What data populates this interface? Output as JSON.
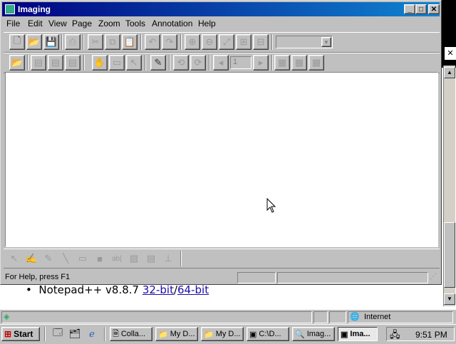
{
  "imaging_window": {
    "title": "Imaging",
    "caption_buttons": {
      "minimize": "_",
      "maximize": "□",
      "close": "✕"
    },
    "menu": [
      "File",
      "Edit",
      "View",
      "Page",
      "Zoom",
      "Tools",
      "Annotation",
      "Help"
    ],
    "toolbar1": {
      "zoom_select_value": ""
    },
    "toolbar2": {
      "page_number": "1"
    },
    "status_text": "For Help, press F1"
  },
  "background_page": {
    "notepad_text": "Notepad++ v8.8.7",
    "link_32": "32-bit",
    "slash": "/",
    "link_64": "64-bit",
    "status_zone": "Internet"
  },
  "taskbar": {
    "start_label": "Start",
    "tasks": [
      "Colla...",
      "My D...",
      "My D...",
      "C:\\D...",
      "Imag...",
      "Ima..."
    ],
    "clock": "9:51 PM"
  }
}
